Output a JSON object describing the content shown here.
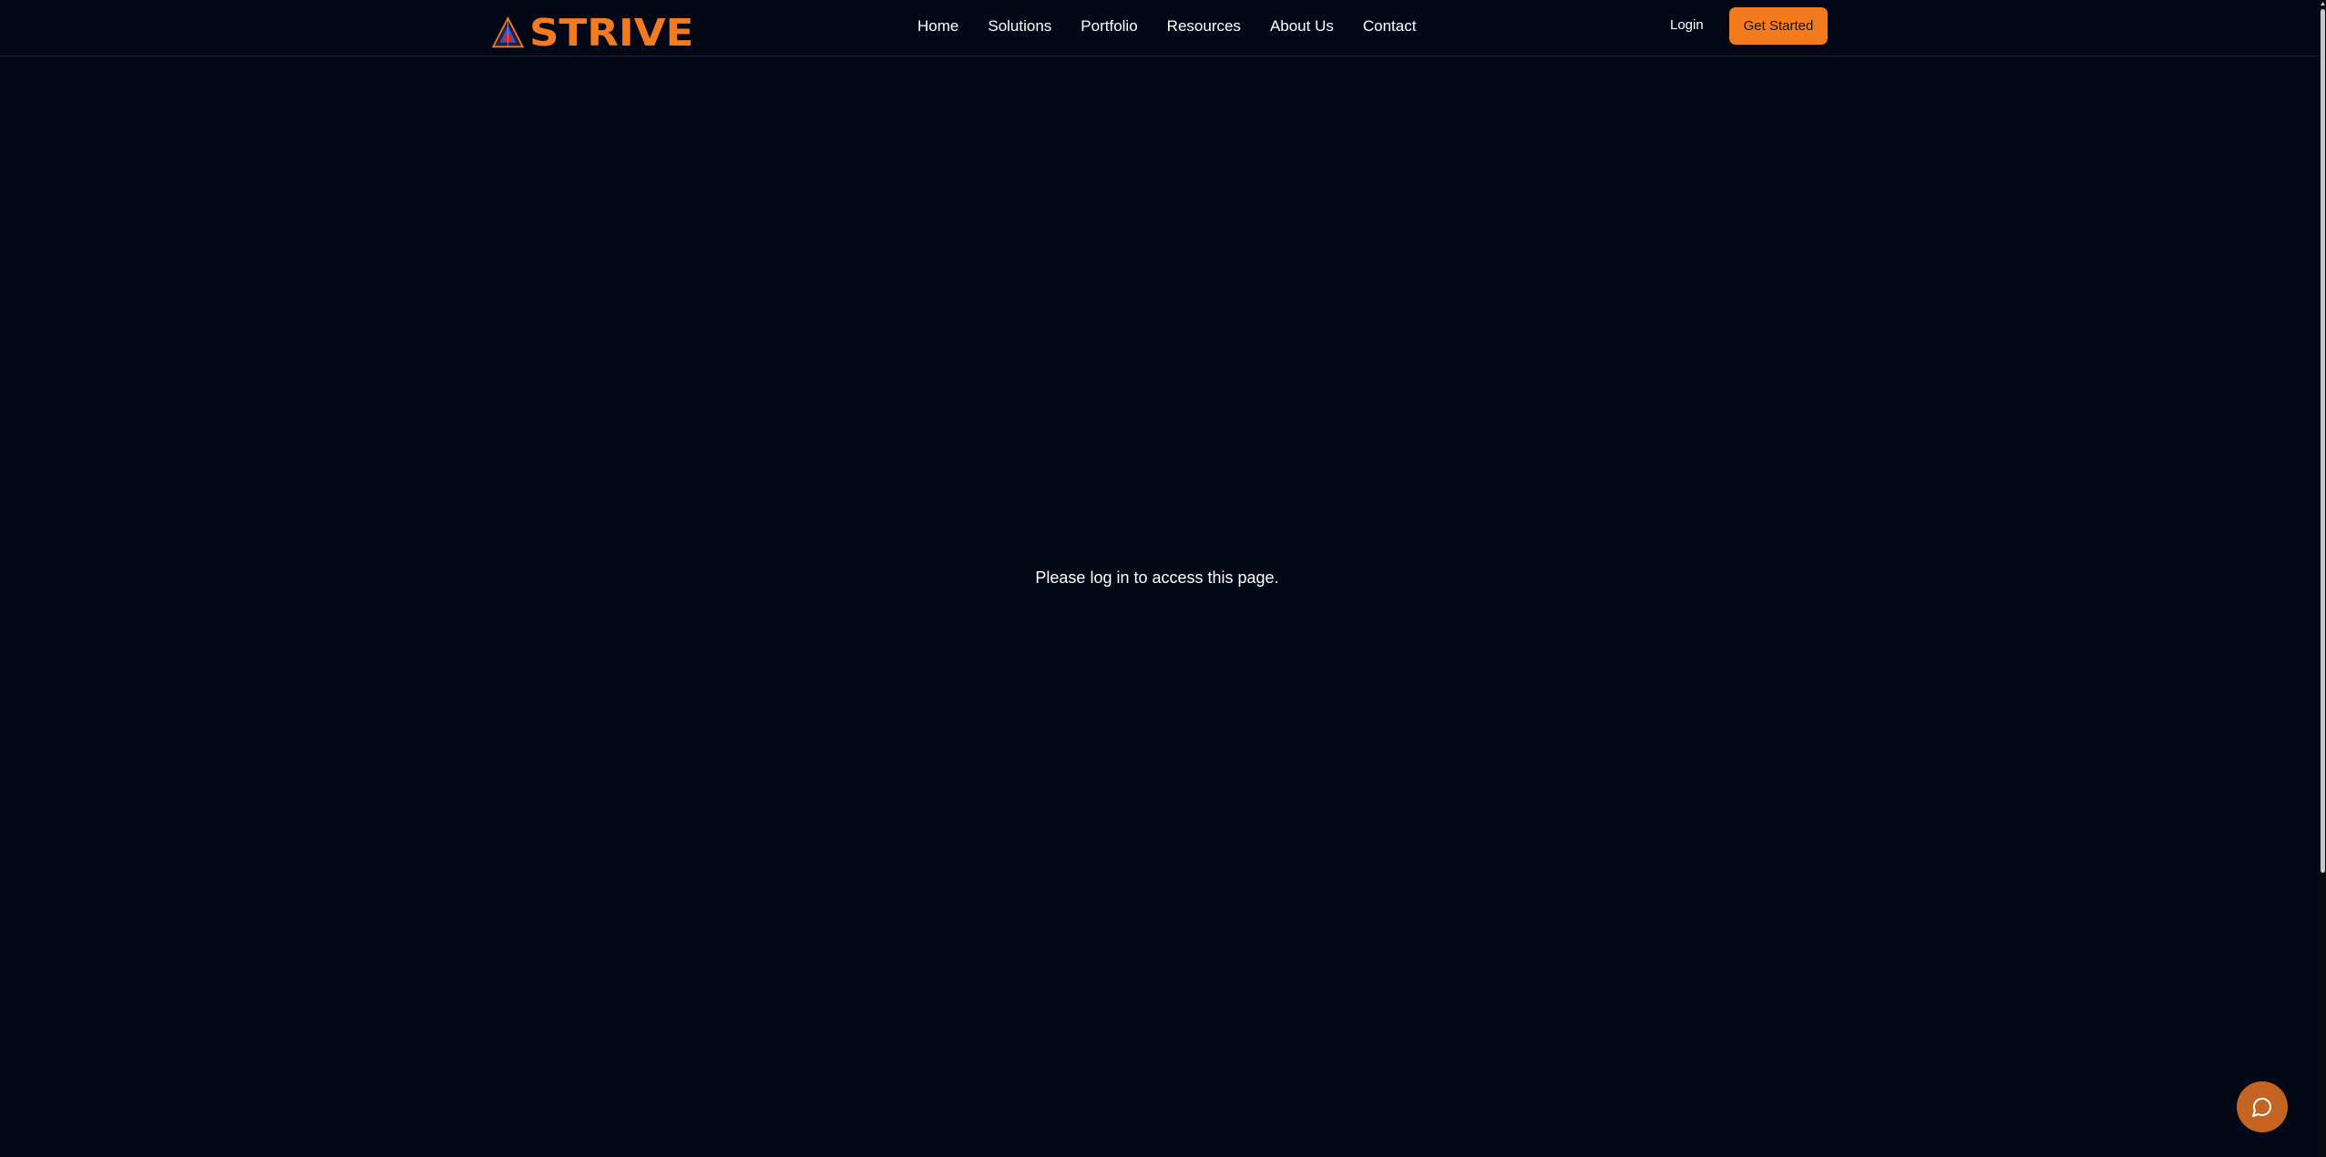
{
  "brand": {
    "name": "STRIVE",
    "color": "#f47a20",
    "logo_icon": "triangle-logo-icon"
  },
  "nav": {
    "links": [
      "Home",
      "Solutions",
      "Portfolio",
      "Resources",
      "About Us",
      "Contact"
    ]
  },
  "auth": {
    "login_label": "Login",
    "cta_label": "Get Started"
  },
  "main": {
    "message": "Please log in to access this page."
  },
  "chat": {
    "icon": "chat-bubble-icon"
  },
  "colors": {
    "background": "#030816",
    "accent": "#f47a20",
    "chat_button": "#c56420"
  }
}
